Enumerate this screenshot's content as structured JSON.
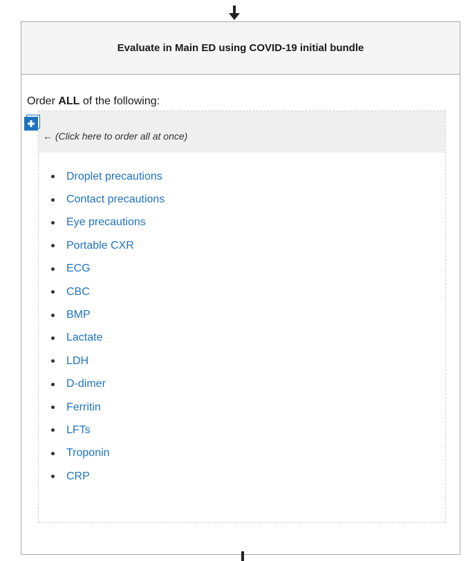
{
  "card": {
    "title": "Evaluate in Main ED using COVID-19 initial bundle"
  },
  "instruction": {
    "prefix": "Order ",
    "emphasis": "ALL",
    "suffix": " of the following:"
  },
  "order_all": {
    "hint": "← (Click here to order all at once)",
    "icon": "plus-icon"
  },
  "orders": [
    "Droplet precautions",
    "Contact precautions",
    "Eye precautions",
    "Portable CXR",
    "ECG",
    "CBC",
    "BMP",
    "Lactate",
    "LDH",
    "D-dimer",
    "Ferritin",
    "LFTs",
    "Troponin",
    "CRP"
  ],
  "colors": {
    "link": "#1e73be",
    "button": "#1e73be",
    "header_bg": "#f5f5f5",
    "border": "#a9a9a9"
  }
}
